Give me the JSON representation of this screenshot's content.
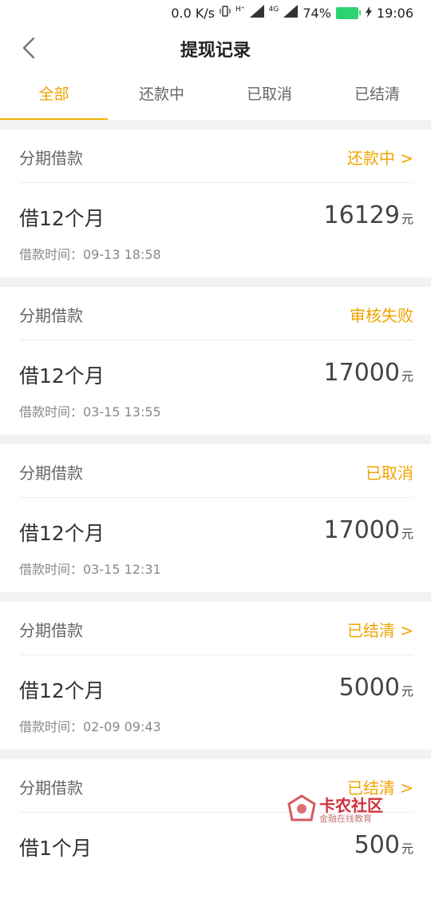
{
  "status_bar": {
    "speed": "0.0 K/s",
    "network_tag_hplus": "H⁺",
    "network_tag_4g": "4G",
    "battery": "74%",
    "time": "19:06"
  },
  "nav": {
    "title": "提现记录"
  },
  "tabs": [
    {
      "label": "全部",
      "active": true
    },
    {
      "label": "还款中",
      "active": false
    },
    {
      "label": "已取消",
      "active": false
    },
    {
      "label": "已结清",
      "active": false
    }
  ],
  "records": [
    {
      "type": "分期借款",
      "status": "还款中 >",
      "term": "借12个月",
      "amount": "16129",
      "unit": "元",
      "time": "借款时间：09-13 18:58"
    },
    {
      "type": "分期借款",
      "status": "审核失败",
      "term": "借12个月",
      "amount": "17000",
      "unit": "元",
      "time": "借款时间：03-15 13:55"
    },
    {
      "type": "分期借款",
      "status": "已取消",
      "term": "借12个月",
      "amount": "17000",
      "unit": "元",
      "time": "借款时间：03-15 12:31"
    },
    {
      "type": "分期借款",
      "status": "已结清 >",
      "term": "借12个月",
      "amount": "5000",
      "unit": "元",
      "time": "借款时间：02-09 09:43"
    },
    {
      "type": "分期借款",
      "status": "已结清 >",
      "term": "借1个月",
      "amount": "500",
      "unit": "元",
      "time": ""
    }
  ],
  "watermark": {
    "title": "卡农社区",
    "subtitle": "金融在线教育"
  },
  "colors": {
    "accent": "#f0a500",
    "battery": "#2dd36f",
    "watermark": "#d0303a"
  }
}
